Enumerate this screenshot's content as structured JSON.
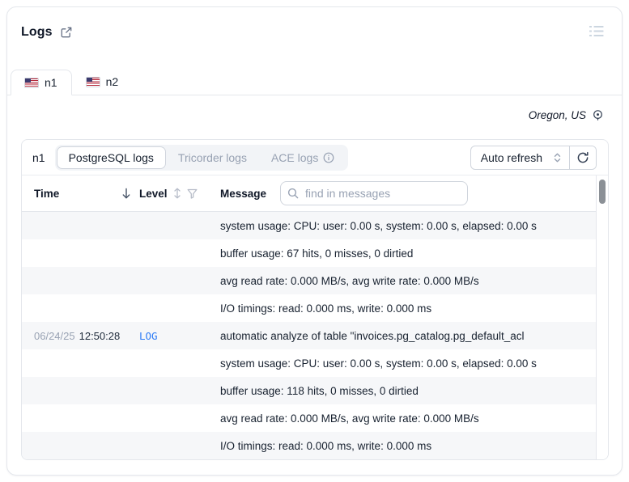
{
  "header": {
    "title": "Logs",
    "region": "Oregon, US"
  },
  "tabs": [
    {
      "label": "n1",
      "active": true
    },
    {
      "label": "n2",
      "active": false
    }
  ],
  "panel": {
    "instance_label": "n1",
    "log_tabs": [
      {
        "label": "PostgreSQL logs",
        "active": true
      },
      {
        "label": "Tricorder logs",
        "active": false
      },
      {
        "label": "ACE logs",
        "active": false,
        "has_info_icon": true
      }
    ],
    "auto_refresh_label": "Auto refresh",
    "columns": {
      "time": "Time",
      "level": "Level",
      "message": "Message"
    },
    "search_placeholder": "find in messages",
    "rows": [
      {
        "date": "",
        "time": "",
        "level": "",
        "message": "system usage: CPU: user: 0.00 s, system: 0.00 s, elapsed: 0.00 s"
      },
      {
        "date": "",
        "time": "",
        "level": "",
        "message": "buffer usage: 67 hits, 0 misses, 0 dirtied"
      },
      {
        "date": "",
        "time": "",
        "level": "",
        "message": "avg read rate: 0.000 MB/s, avg write rate: 0.000 MB/s"
      },
      {
        "date": "",
        "time": "",
        "level": "",
        "message": "I/O timings: read: 0.000 ms, write: 0.000 ms"
      },
      {
        "date": "06/24/25",
        "time": "12:50:28",
        "level": "LOG",
        "message": "automatic analyze of table \"invoices.pg_catalog.pg_default_acl"
      },
      {
        "date": "",
        "time": "",
        "level": "",
        "message": "system usage: CPU: user: 0.00 s, system: 0.00 s, elapsed: 0.00 s"
      },
      {
        "date": "",
        "time": "",
        "level": "",
        "message": "buffer usage: 118 hits, 0 misses, 0 dirtied"
      },
      {
        "date": "",
        "time": "",
        "level": "",
        "message": "avg read rate: 0.000 MB/s, avg write rate: 0.000 MB/s"
      },
      {
        "date": "",
        "time": "",
        "level": "",
        "message": "I/O timings: read: 0.000 ms, write: 0.000 ms"
      }
    ]
  },
  "icons": {
    "external_link": "open-in-new-window",
    "list": "list-lines",
    "location": "location-pin",
    "info": "info-circle",
    "sort_desc": "arrow-down",
    "sort_both": "arrows-up-down",
    "filter": "funnel",
    "search": "magnifier",
    "select_chevrons": "up-down-carets",
    "refresh": "circular-arrow"
  },
  "colors": {
    "accent_blue": "#2e7cf6",
    "border": "#e4e7ec",
    "muted_text": "#98a2b3",
    "text": "#182230",
    "row_stripe": "#f6f7f9",
    "scroll_thumb": "#8b9096"
  }
}
